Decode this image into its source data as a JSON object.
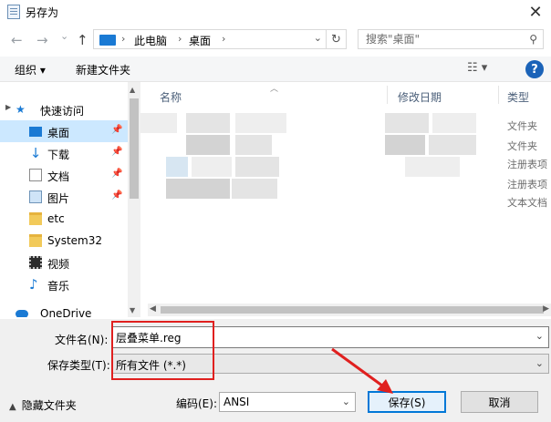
{
  "window": {
    "title": "另存为",
    "close_glyph": "✕"
  },
  "nav": {
    "back": "←",
    "forward": "→",
    "recent": "⌄",
    "up": "↑",
    "breadcrumb": [
      "此电脑",
      "桌面"
    ],
    "refresh": "↻",
    "search_placeholder": "搜索\"桌面\""
  },
  "toolbar": {
    "organize": "组织 ▾",
    "new_folder": "新建文件夹",
    "view": "☷ ▾",
    "help": "?"
  },
  "sidebar": {
    "items": [
      {
        "label": "快速访问",
        "icon": "star-icon"
      },
      {
        "label": "桌面",
        "icon": "desktop-icon",
        "pinned": true,
        "selected": true
      },
      {
        "label": "下载",
        "icon": "download-icon",
        "pinned": true
      },
      {
        "label": "文档",
        "icon": "document-icon",
        "pinned": true
      },
      {
        "label": "图片",
        "icon": "pictures-icon",
        "pinned": true
      },
      {
        "label": "etc",
        "icon": "folder-icon"
      },
      {
        "label": "System32",
        "icon": "folder-icon"
      },
      {
        "label": "视频",
        "icon": "video-icon"
      },
      {
        "label": "音乐",
        "icon": "music-icon"
      },
      {
        "label": "OneDrive",
        "icon": "cloud-icon"
      }
    ]
  },
  "file_list": {
    "columns": [
      "名称",
      "修改日期",
      "类型"
    ],
    "types": [
      "文件夹",
      "文件夹",
      "注册表项",
      "注册表项",
      "文本文档"
    ]
  },
  "form": {
    "filename_label": "文件名(N):",
    "filename_value": "层叠菜单.reg",
    "filetype_label": "保存类型(T):",
    "filetype_value": "所有文件 (*.*)",
    "hide_folders": "隐藏文件夹",
    "encoding_label": "编码(E):",
    "encoding_value": "ANSI",
    "save": "保存(S)",
    "cancel": "取消"
  },
  "colors": {
    "highlight": "#e0201f",
    "accent": "#0078d7",
    "selection": "#cce8ff"
  }
}
